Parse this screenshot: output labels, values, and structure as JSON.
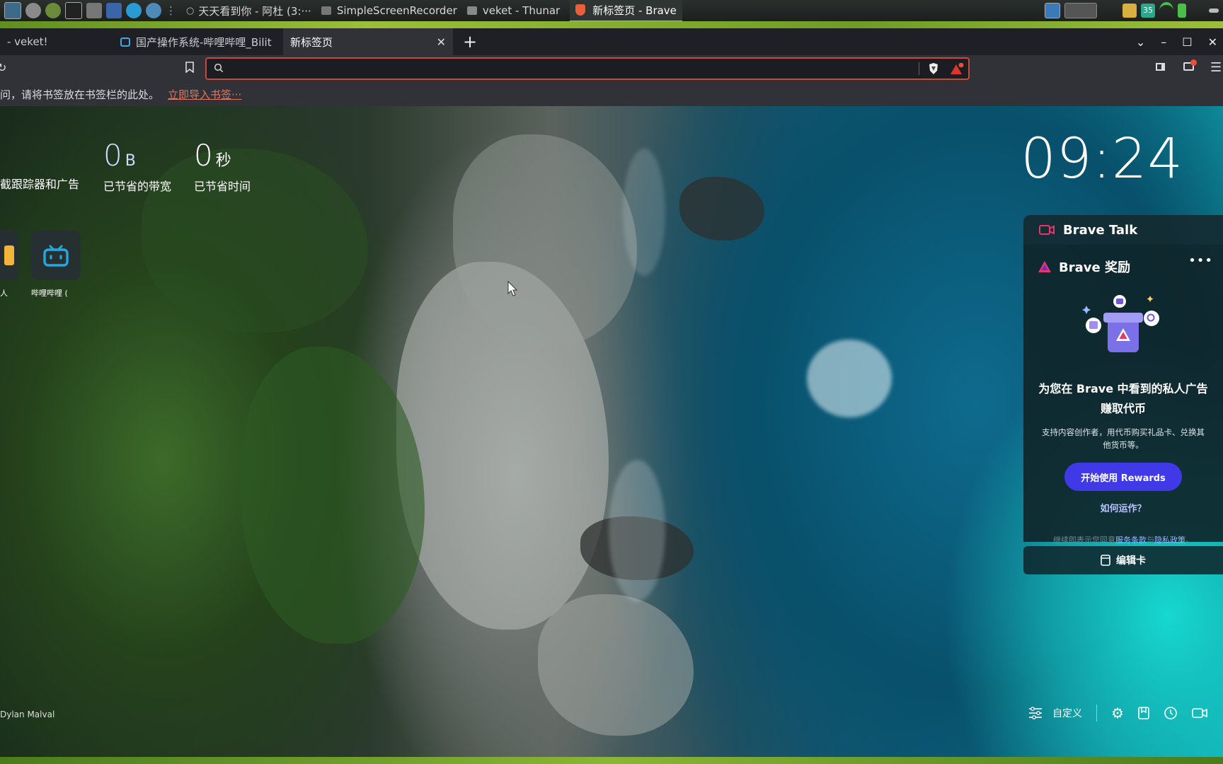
{
  "taskbar": {
    "tasks": [
      {
        "label": "天天看到你 - 阿杜 (3:···"
      },
      {
        "label": "SimpleScreenRecorder"
      },
      {
        "label": "veket - Thunar"
      },
      {
        "label": "新标签页 - Brave"
      }
    ],
    "battery_temp": "35"
  },
  "browser": {
    "tabs": [
      {
        "label": "- veket!"
      },
      {
        "label": "国产操作系统-哔哩哔哩_Bilit"
      },
      {
        "label": "新标签页"
      }
    ],
    "url_value": "",
    "bookmarks_bar": {
      "hint": "问，请将书签放在书签栏的此处。",
      "import_link": "立即导入书签···"
    }
  },
  "ntp": {
    "stats": [
      {
        "value": "",
        "unit": "",
        "label": "截跟踪器和广告"
      },
      {
        "value": "0",
        "unit": "B",
        "label": "已节省的带宽"
      },
      {
        "value": "0",
        "unit": "秒",
        "label": "已节省时间"
      }
    ],
    "sites": [
      {
        "label": "人"
      },
      {
        "label": "哔哩哔哩 ("
      }
    ],
    "clock": "09:24",
    "brave_talk": {
      "title": "Brave Talk"
    },
    "rewards": {
      "title": "Brave 奖励",
      "heading_line1": "为您在 Brave 中看到的私人广告",
      "heading_line2": "赚取代币",
      "desc_line1": "支持内容创作者，用代币购买礼品卡、兑换其",
      "desc_line2": "他货币等。",
      "button": "开始使用 Rewards",
      "how": "如何运作？",
      "terms_prefix": "继续即表示您同意",
      "terms_tos": "服务条款",
      "terms_and": "与",
      "terms_privacy": "隐私政策",
      "terms_suffix": "。"
    },
    "edit_cards": "编辑卡",
    "photo_credit": "Dylan Malval",
    "customize": "自定义"
  },
  "colors": {
    "accent_red": "#c94a3a",
    "rewards_button": "#3f39e8",
    "taskbar_green": "#8ab635"
  }
}
